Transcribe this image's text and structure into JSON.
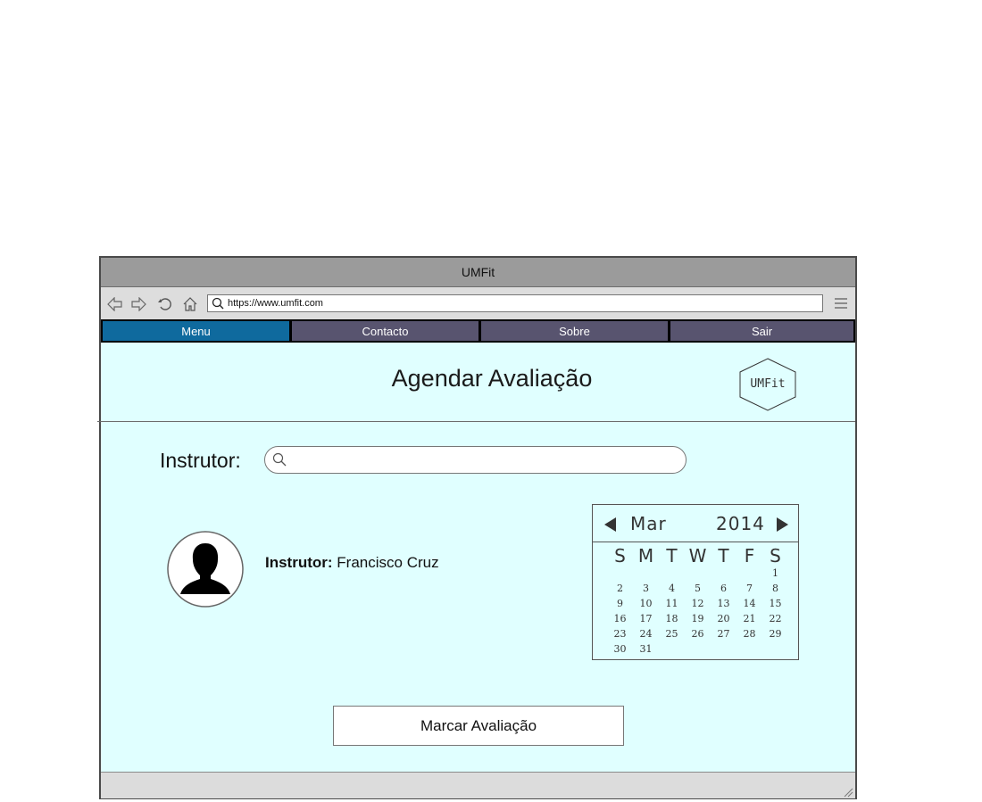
{
  "window": {
    "title": "UMFit"
  },
  "browser": {
    "url": "https://www.umfit.com",
    "icons": [
      "back-icon",
      "forward-icon",
      "reload-icon",
      "home-icon",
      "search-icon",
      "hamburger-menu-icon"
    ]
  },
  "tabs": [
    {
      "label": "Menu",
      "active": true
    },
    {
      "label": "Contacto",
      "active": false
    },
    {
      "label": "Sobre",
      "active": false
    },
    {
      "label": "Sair",
      "active": false
    }
  ],
  "page": {
    "title": "Agendar Avaliação",
    "logo_text": "UMFit"
  },
  "search": {
    "label": "Instrutor:",
    "value": "",
    "placeholder": ""
  },
  "instructor": {
    "label": "Instrutor:",
    "name": "Francisco Cruz"
  },
  "calendar": {
    "month": "Mar",
    "year": "2014",
    "weekdays": [
      "S",
      "M",
      "T",
      "W",
      "T",
      "F",
      "S"
    ],
    "first_weekday_index": 6,
    "days": [
      "1",
      "2",
      "3",
      "4",
      "5",
      "6",
      "7",
      "8",
      "9",
      "10",
      "11",
      "12",
      "13",
      "14",
      "15",
      "16",
      "17",
      "18",
      "19",
      "20",
      "21",
      "22",
      "23",
      "24",
      "25",
      "26",
      "27",
      "28",
      "29",
      "30",
      "31"
    ]
  },
  "actions": {
    "book_label": "Marcar Avaliação"
  },
  "colors": {
    "content_bg": "#e0ffff",
    "tab_active": "#0f6a9e",
    "tab_inactive": "#58546f",
    "titlebar": "#9b9b9b"
  }
}
